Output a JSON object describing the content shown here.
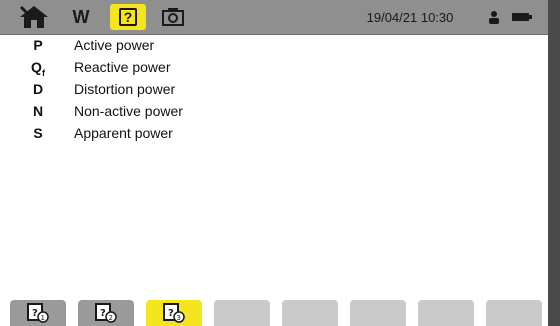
{
  "status_bar": {
    "home_icon": "home-icon",
    "mode_label": "W",
    "help_label": "?",
    "camera_icon": "camera-icon",
    "datetime": "19/04/21 10:30",
    "person_icon": "person-icon",
    "battery_icon": "battery-icon",
    "accent_color": "#f5e51f"
  },
  "power_list": [
    {
      "symbol": "P",
      "subscript": "",
      "label": "Active power"
    },
    {
      "symbol": "Q",
      "subscript": "f",
      "label": "Reactive power"
    },
    {
      "symbol": "D",
      "subscript": "",
      "label": "Distortion power"
    },
    {
      "symbol": "N",
      "subscript": "",
      "label": "Non-active power"
    },
    {
      "symbol": "S",
      "subscript": "",
      "label": "Apparent power"
    }
  ],
  "bottom_tabs": [
    {
      "icon": "help-page-1-icon",
      "state": "inactive"
    },
    {
      "icon": "help-page-2-icon",
      "state": "inactive"
    },
    {
      "icon": "help-page-3-icon",
      "state": "active"
    },
    {
      "icon": "",
      "state": "empty"
    },
    {
      "icon": "",
      "state": "empty"
    },
    {
      "icon": "",
      "state": "empty"
    },
    {
      "icon": "",
      "state": "empty"
    },
    {
      "icon": "",
      "state": "empty"
    }
  ]
}
